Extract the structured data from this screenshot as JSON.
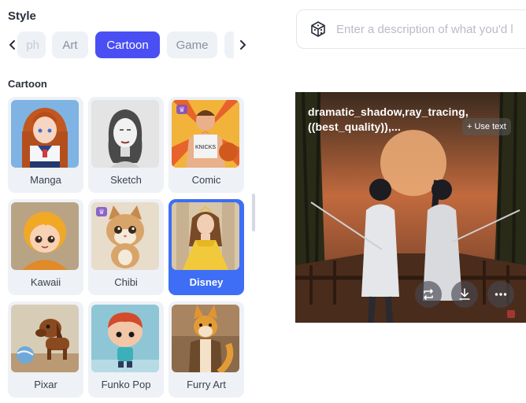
{
  "style_panel": {
    "heading": "Style",
    "tabs": [
      {
        "label": "ph"
      },
      {
        "label": "Art"
      },
      {
        "label": "Cartoon"
      },
      {
        "label": "Game"
      },
      {
        "label": ""
      }
    ],
    "selected_tab": "Cartoon",
    "section_label": "Cartoon",
    "cards": [
      {
        "label": "Manga",
        "premium": false
      },
      {
        "label": "Sketch",
        "premium": false
      },
      {
        "label": "Comic",
        "premium": true
      },
      {
        "label": "Kawaii",
        "premium": false
      },
      {
        "label": "Chibi",
        "premium": true
      },
      {
        "label": "Disney",
        "premium": false
      },
      {
        "label": "Pixar",
        "premium": false
      },
      {
        "label": "Funko Pop",
        "premium": false
      },
      {
        "label": "Furry Art",
        "premium": false
      }
    ],
    "selected_card": "Disney"
  },
  "prompt": {
    "placeholder": "Enter a description of what you'd l"
  },
  "artwork": {
    "prompt_text": "dramatic_shadow,ray_tracing,((best_quality)),...",
    "use_text_label": "+ Use text"
  },
  "colors": {
    "accent": "#4a4ff3",
    "selected_card": "#3d6ef5",
    "card_bg": "#eef1f6"
  }
}
